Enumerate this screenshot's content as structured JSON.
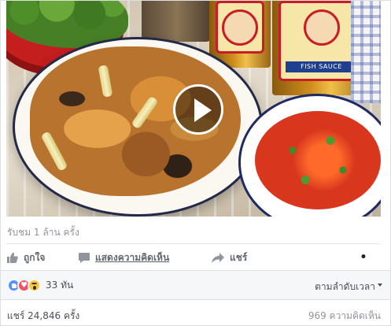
{
  "media": {
    "bottle_label": "FISH SAUCE"
  },
  "stats": {
    "views": "รับชม 1 ล้าน ครั้ง"
  },
  "actions": {
    "like": "ถูกใจ",
    "comment": "แสดงความคิดเห็น",
    "share": "แชร์",
    "more": "•"
  },
  "reactions": {
    "types": [
      "like",
      "love",
      "wow"
    ],
    "count": "33 ทัน"
  },
  "sort": {
    "label": "ตามลำดับเวลา"
  },
  "footer": {
    "shares": "แชร์ 24,846 ครั้ง",
    "comments": "969 ความคิดเห็น"
  },
  "colors": {
    "like_blue": "#5890ff",
    "love_red": "#f25268",
    "wow_yellow": "#f7c844",
    "text_secondary": "#90949c"
  }
}
